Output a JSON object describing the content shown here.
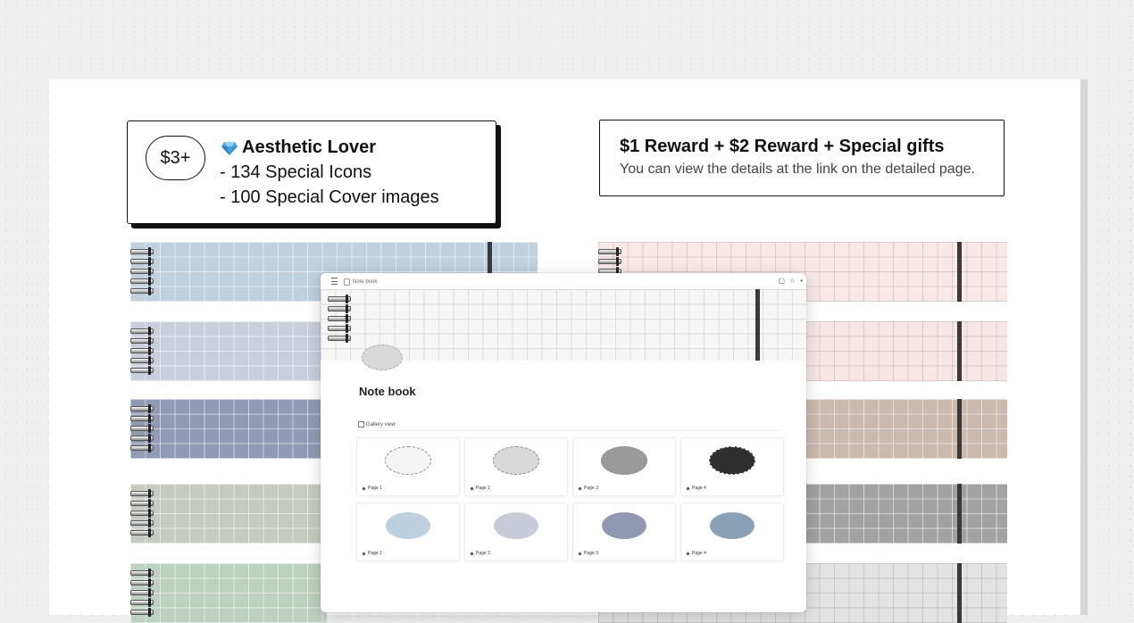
{
  "tier": {
    "price": "$3+",
    "icon": "gem-icon",
    "title": "Aesthetic Lover",
    "line1": "- 134 Special Icons",
    "line2": "- 100 Special Cover images"
  },
  "reward": {
    "title": "$1 Reward + $2 Reward + Special gifts",
    "subtitle": "You can view the details at the link on the detailed page."
  },
  "covers": {
    "left": [
      {
        "color": "#bfd0de"
      },
      {
        "color": "#c8cedb"
      },
      {
        "color": "#919ab3"
      },
      {
        "color": "#c6cbc1"
      },
      {
        "color": "#bdd1c1"
      }
    ],
    "right": [
      {
        "color": "#f9e8e8"
      },
      {
        "color": "#f7e6e6"
      },
      {
        "color": "#cbb9ad"
      },
      {
        "color": "#a2a2a2"
      },
      {
        "color": "#e3e3e3"
      }
    ]
  },
  "notion": {
    "breadcrumb": "Note book",
    "title": "Note book",
    "view_label": "Gallery view",
    "gallery": [
      {
        "label": "Page 1",
        "color": "#f4f4f4",
        "style": "dashed"
      },
      {
        "label": "Page 2",
        "color": "#d9d9d9",
        "style": "dashed"
      },
      {
        "label": "Page 3",
        "color": "#9a9a9a",
        "style": "dashed"
      },
      {
        "label": "Page 4",
        "color": "#2f2f2f",
        "style": "dashed"
      },
      {
        "label": "Page 1",
        "color": "#bcd0e0",
        "style": "solid"
      },
      {
        "label": "Page 2",
        "color": "#c7ccd8",
        "style": "solid"
      },
      {
        "label": "Page 3",
        "color": "#9098b2",
        "style": "solid"
      },
      {
        "label": "Page 4",
        "color": "#8aa0b4",
        "style": "solid"
      }
    ]
  }
}
